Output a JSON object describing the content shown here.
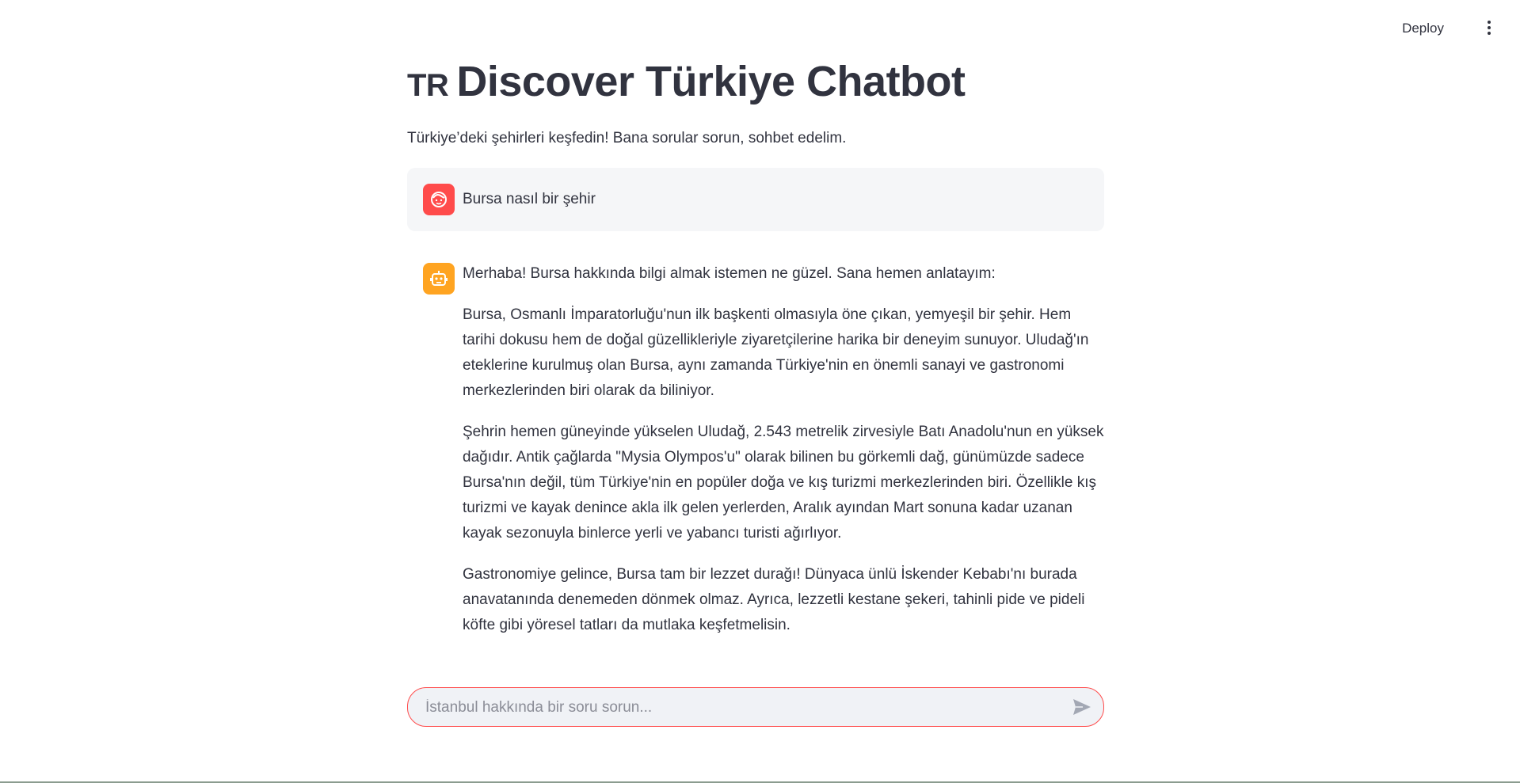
{
  "header": {
    "deploy_label": "Deploy",
    "menu_icon": "kebab-menu-icon"
  },
  "page": {
    "flag_text": "TR",
    "title": "Discover Türkiye Chatbot",
    "subtitle": "Türkiye’deki şehirleri keşfedin! Bana sorular sorun, sohbet edelim."
  },
  "messages": {
    "user": {
      "avatar_icon": "user-face-icon",
      "text": "Bursa nasıl bir şehir"
    },
    "assistant": {
      "avatar_icon": "robot-icon",
      "paragraphs": [
        "Merhaba! Bursa hakkında bilgi almak istemen ne güzel. Sana hemen anlatayım:",
        "Bursa, Osmanlı İmparatorluğu'nun ilk başkenti olmasıyla öne çıkan, yemyeşil bir şehir. Hem tarihi dokusu hem de doğal güzellikleriyle ziyaretçilerine harika bir deneyim sunuyor. Uludağ'ın eteklerine kurulmuş olan Bursa, aynı zamanda Türkiye'nin en önemli sanayi ve gastronomi merkezlerinden biri olarak da biliniyor.",
        "Şehrin hemen güneyinde yükselen Uludağ, 2.543 metrelik zirvesiyle Batı Anadolu'nun en yüksek dağıdır. Antik çağlarda \"Mysia Olympos'u\" olarak bilinen bu görkemli dağ, günümüzde sadece Bursa'nın değil, tüm Türkiye'nin en popüler doğa ve kış turizmi merkezlerinden biri. Özellikle kış turizmi ve kayak denince akla ilk gelen yerlerden, Aralık ayından Mart sonuna kadar uzanan kayak sezonuyla binlerce yerli ve yabancı turisti ağırlıyor.",
        "Gastronomiye gelince, Bursa tam bir lezzet durağı! Dünyaca ünlü İskender Kebabı'nı burada anavatanında denemeden dönmek olmaz. Ayrıca, lezzetli kestane şekeri, tahinli pide ve pideli köfte gibi yöresel tatları da mutlaka keşfetmelisin."
      ]
    }
  },
  "chat_input": {
    "placeholder": "İstanbul hakkında bir soru sorun...",
    "value": "",
    "send_icon": "send-icon"
  },
  "colors": {
    "user_avatar": "#ff4b4b",
    "bot_avatar": "#ffa421",
    "input_border": "#ff4b4b",
    "text": "#31333f"
  }
}
